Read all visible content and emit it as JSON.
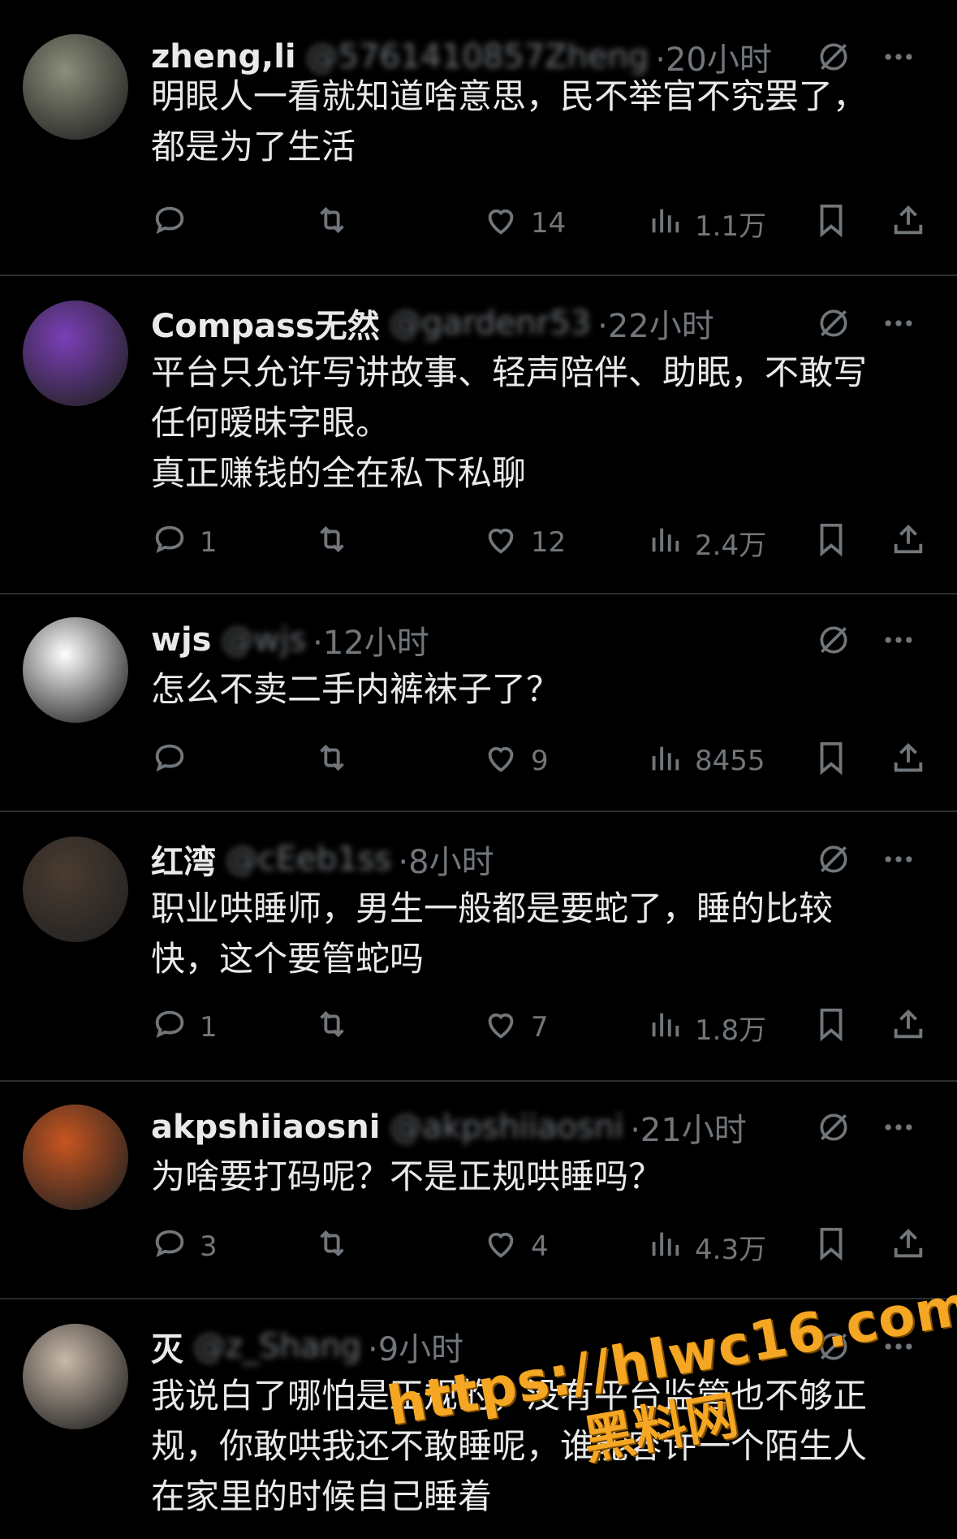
{
  "posts": [
    {
      "name": "zheng,li",
      "handle": "@5761410857Zheng",
      "time": "·20小时",
      "text": "明眼人一看就知道啥意思，民不举官不究罢了，\n都是为了生活",
      "replies": "",
      "likes": "14",
      "views": "1.1万",
      "avatar_color": "#8a8f7a"
    },
    {
      "name": "Compass无然",
      "handle": "@gardenr53",
      "time": "·22小时",
      "text": "平台只允许写讲故事、轻声陪伴、助眠，不敢写\n任何暧昧字眼。\n真正赚钱的全在私下私聊",
      "replies": "1",
      "likes": "12",
      "views": "2.4万",
      "avatar_color": "#7b3fb8"
    },
    {
      "name": "wjs",
      "handle": "@wjs",
      "time": "·12小时",
      "text": "怎么不卖二手内裤袜子了？",
      "replies": "",
      "likes": "9",
      "views": "8455",
      "avatar_color": "#ffffff"
    },
    {
      "name": "红湾",
      "handle": "@cEeb1ss",
      "time": "·8小时",
      "text": "职业哄睡师，男生一般都是要蛇了，睡的比较\n快，这个要管蛇吗",
      "replies": "1",
      "likes": "7",
      "views": "1.8万",
      "avatar_color": "#4a3b30"
    },
    {
      "name": "akpshiiaosni",
      "handle": "@akpshiiaosni",
      "time": "·21小时",
      "text": "为啥要打码呢？不是正规哄睡吗？",
      "replies": "3",
      "likes": "4",
      "views": "4.3万",
      "avatar_color": "#c8551f"
    },
    {
      "name": "灭",
      "handle": "@z_Shang",
      "time": "·9小时",
      "text": "我说白了哪怕是正规的，没有平台监管也不够正\n规，你敢哄我还不敢睡呢，谁能容许一个陌生人\n在家里的时候自己睡着",
      "replies": "",
      "likes": "",
      "views": "",
      "avatar_color": "#c9b8a8"
    }
  ],
  "watermark": {
    "url": "https://hlwc16.com",
    "cn": "黑料网"
  },
  "icons": {
    "grok": "grok-icon",
    "more": "more-icon",
    "reply": "reply-icon",
    "repost": "repost-icon",
    "like": "like-icon",
    "views": "views-icon",
    "bookmark": "bookmark-icon",
    "share": "share-icon"
  },
  "colors": {
    "background": "#000000",
    "text": "#e7e9ea",
    "muted": "#71767b",
    "watermark": "#f5a623"
  }
}
